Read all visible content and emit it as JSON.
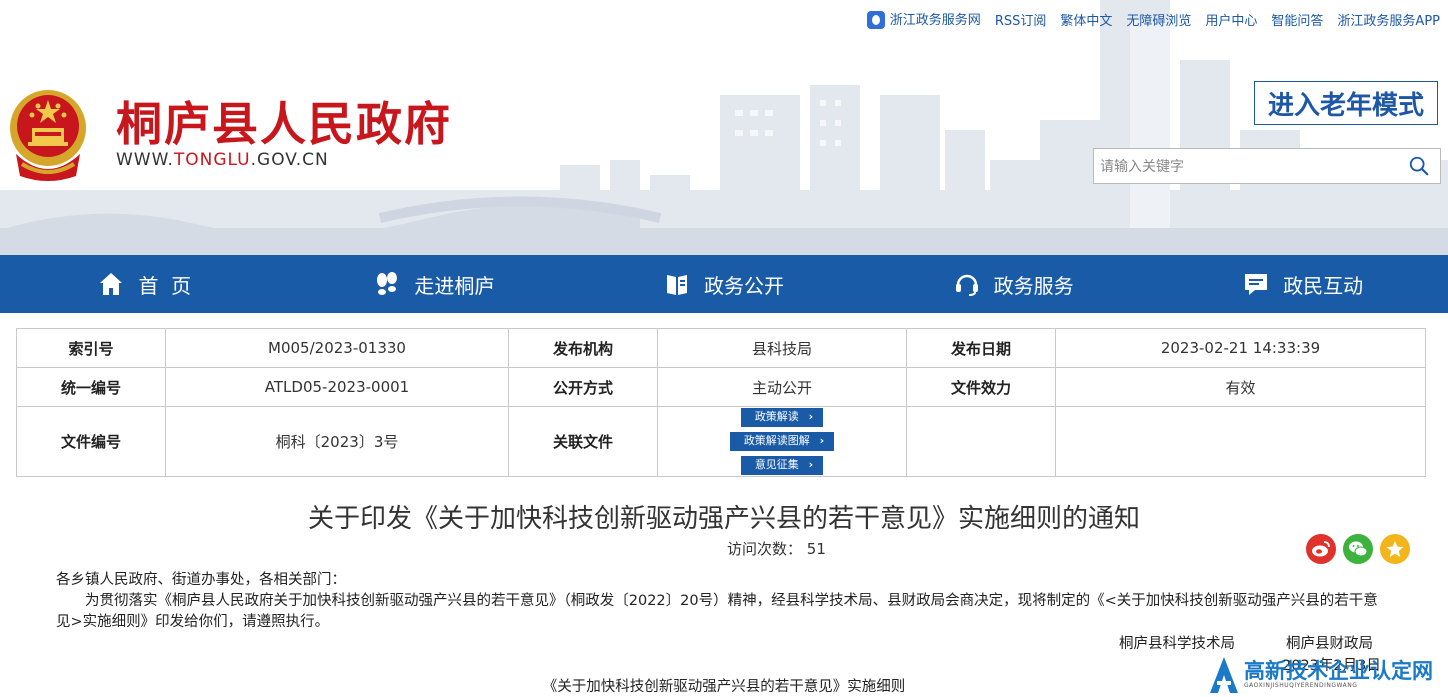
{
  "topbar": {
    "links": [
      "浙江政务服务网",
      "RSS订阅",
      "繁体中文",
      "无障碍浏览",
      "用户中心",
      "智能问答",
      "浙江政务服务APP"
    ]
  },
  "site": {
    "title": "桐庐县人民政府",
    "url_prefix": "WWW.",
    "url_highlight": "TONGLU",
    "url_suffix": ".GOV.CN"
  },
  "elder_mode": "进入老年模式",
  "search": {
    "placeholder": "请输入关键字"
  },
  "nav": [
    {
      "label": "首  页",
      "icon": "home-icon"
    },
    {
      "label": "走进桐庐",
      "icon": "footprint-icon"
    },
    {
      "label": "政务公开",
      "icon": "book-icon"
    },
    {
      "label": "政务服务",
      "icon": "headset-icon"
    },
    {
      "label": "政民互动",
      "icon": "message-icon"
    }
  ],
  "meta": {
    "index_no_label": "索引号",
    "index_no": "M005/2023-01330",
    "publisher_label": "发布机构",
    "publisher": "县科技局",
    "date_label": "发布日期",
    "date": "2023-02-21 14:33:39",
    "unified_no_label": "统一编号",
    "unified_no": "ATLD05-2023-0001",
    "open_mode_label": "公开方式",
    "open_mode": "主动公开",
    "validity_label": "文件效力",
    "validity": "有效",
    "doc_no_label": "文件编号",
    "doc_no": "桐科〔2023〕3号",
    "related_label": "关联文件",
    "related": [
      "政策解读",
      "政策解读图解",
      "意见征集"
    ]
  },
  "article": {
    "title": "关于印发《关于加快科技创新驱动强产兴县的若干意见》实施细则的通知",
    "visits_label": "访问次数：",
    "visits": "51",
    "salutation": "各乡镇人民政府、街道办事处，各相关部门：",
    "paragraph": "为贯彻落实《桐庐县人民政府关于加快科技创新驱动强产兴县的若干意见》（桐政发〔2022〕20号）精神，经县科学技术局、县财政局会商决定，现将制定的《<关于加快科技创新驱动强产兴县的若干意见>实施细则》印发给你们，请遵照执行。",
    "sign1": "桐庐县科学技术局",
    "sign2": "桐庐县财政局",
    "date": "2023年2月3日",
    "subtitle": "《关于加快科技创新驱动强产兴县的若干意见》实施细则"
  },
  "watermark": {
    "text": "高新技术企业认定网",
    "sub": "GAOXINJISHUQIYERENDINGWANG"
  },
  "colors": {
    "brand_red": "#c8161d",
    "nav_blue": "#1a5ba8"
  }
}
